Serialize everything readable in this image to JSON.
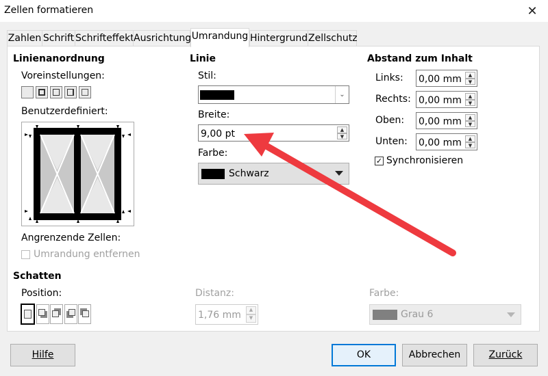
{
  "window": {
    "title": "Zellen formatieren"
  },
  "tabs": [
    {
      "label": "Zahlen"
    },
    {
      "label": "Schrift"
    },
    {
      "label": "Schrifteffekt"
    },
    {
      "label": "Ausrichtung"
    },
    {
      "label": "Umrandung"
    },
    {
      "label": "Hintergrund"
    },
    {
      "label": "Zellschutz"
    }
  ],
  "line_arrangement": {
    "heading": "Linienanordnung",
    "presets_label": "Voreinstellungen:",
    "custom_label": "Benutzerdefiniert:",
    "adjacent_label": "Angrenzende Zellen:",
    "remove_border_label": "Umrandung entfernen"
  },
  "line": {
    "heading": "Linie",
    "style_label": "Stil:",
    "width_label": "Breite:",
    "width_value": "9,00 pt",
    "color_label": "Farbe:",
    "color_value": "Schwarz"
  },
  "padding": {
    "heading": "Abstand zum Inhalt",
    "left_label": "Links:",
    "left_value": "0,00 mm",
    "right_label": "Rechts:",
    "right_value": "0,00 mm",
    "top_label": "Oben:",
    "top_value": "0,00 mm",
    "bottom_label": "Unten:",
    "bottom_value": "0,00 mm",
    "sync_label": "Synchronisieren",
    "sync_checked": true
  },
  "shadow": {
    "heading": "Schatten",
    "position_label": "Position:",
    "distance_label": "Distanz:",
    "distance_value": "1,76 mm",
    "color_label": "Farbe:",
    "color_value": "Grau 6"
  },
  "buttons": {
    "help": "Hilfe",
    "ok": "OK",
    "cancel": "Abbrechen",
    "reset": "Zurück"
  },
  "colors": {
    "accent": "#0078d7",
    "annotation_arrow": "#ee3a3f",
    "line_color": "#000000",
    "shadow_color": "#808080"
  }
}
